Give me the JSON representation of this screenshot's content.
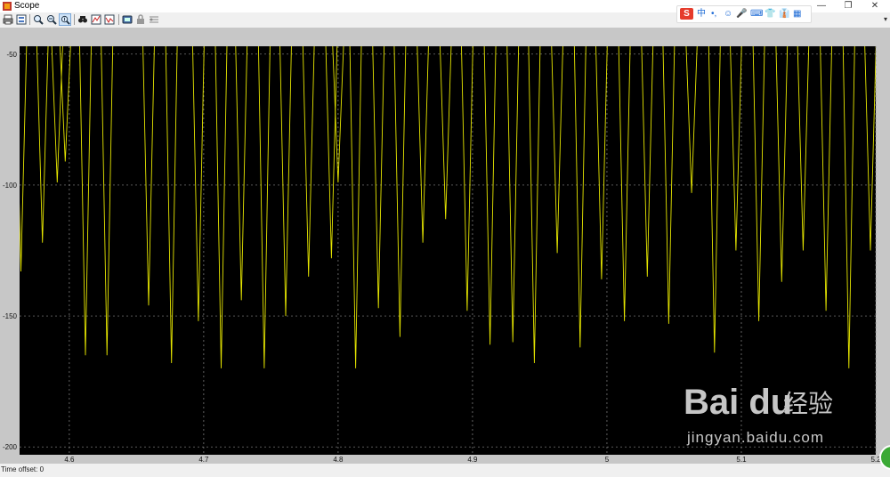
{
  "window": {
    "title": "Scope",
    "minimize": "—",
    "restore": "❐",
    "close": "✕"
  },
  "ime_toolbar": {
    "logo": "S",
    "lang": "中",
    "items": [
      "•,",
      "☺",
      "🎤",
      "⌨",
      "👕",
      "👔",
      "▦"
    ]
  },
  "toolbar": {
    "buttons": [
      "print-icon",
      "params-icon",
      "zoom-in-icon",
      "zoom-x-icon",
      "zoom-y-icon",
      "autoscale-icon",
      "save-axes-icon",
      "restore-axes-icon",
      "floating-scope-icon",
      "lock-axes-icon",
      "signal-selection-icon"
    ]
  },
  "status": {
    "time_offset_label": "Time offset:",
    "time_offset_value": "0"
  },
  "watermark": {
    "brand": "Bai du",
    "product": "经验",
    "url": "jingyan.baidu.com"
  },
  "colors": {
    "plot_bg": "#000000",
    "trace": "#e6e600",
    "grid": "#8a8a8a",
    "frame": "#c7c7c7"
  },
  "chart_data": {
    "type": "line",
    "title": "",
    "xlabel": "",
    "ylabel": "",
    "xlim": [
      4.563,
      5.2
    ],
    "ylim": [
      -203,
      -47
    ],
    "xticks": [
      4.6,
      4.7,
      4.8,
      4.9,
      5,
      5.1,
      5.2
    ],
    "xtick_labels": [
      "4.6",
      "4.7",
      "4.8",
      "4.9",
      "5",
      "5.1",
      "5.2"
    ],
    "yticks": [
      -50,
      -100,
      -150,
      -200
    ],
    "ytick_labels": [
      "-50",
      "-100",
      "-150",
      "-200"
    ],
    "grid": true,
    "series": [
      {
        "color": "#e6e600",
        "minima": [
          [
            4.564,
            -133
          ],
          [
            4.58,
            -122
          ],
          [
            4.591,
            -99
          ],
          [
            4.597,
            -91
          ],
          [
            4.612,
            -165
          ],
          [
            4.628,
            -165
          ],
          [
            4.659,
            -146
          ],
          [
            4.676,
            -168
          ],
          [
            4.696,
            -152
          ],
          [
            4.713,
            -170
          ],
          [
            4.728,
            -144
          ],
          [
            4.745,
            -170
          ],
          [
            4.761,
            -150
          ],
          [
            4.778,
            -135
          ],
          [
            4.795,
            -128
          ],
          [
            4.8,
            -99
          ],
          [
            4.813,
            -170
          ],
          [
            4.83,
            -147
          ],
          [
            4.846,
            -158
          ],
          [
            4.863,
            -122
          ],
          [
            4.88,
            -113
          ],
          [
            4.896,
            -148
          ],
          [
            4.913,
            -161
          ],
          [
            4.93,
            -160
          ],
          [
            4.946,
            -168
          ],
          [
            4.963,
            -126
          ],
          [
            4.98,
            -162
          ],
          [
            4.996,
            -136
          ],
          [
            5.013,
            -152
          ],
          [
            5.03,
            -135
          ],
          [
            5.046,
            -153
          ],
          [
            5.063,
            -103
          ],
          [
            5.08,
            -164
          ],
          [
            5.096,
            -125
          ],
          [
            5.113,
            -152
          ],
          [
            5.13,
            -137
          ],
          [
            5.146,
            -125
          ],
          [
            5.163,
            -148
          ],
          [
            5.18,
            -170
          ],
          [
            5.196,
            -125
          ]
        ]
      }
    ]
  }
}
